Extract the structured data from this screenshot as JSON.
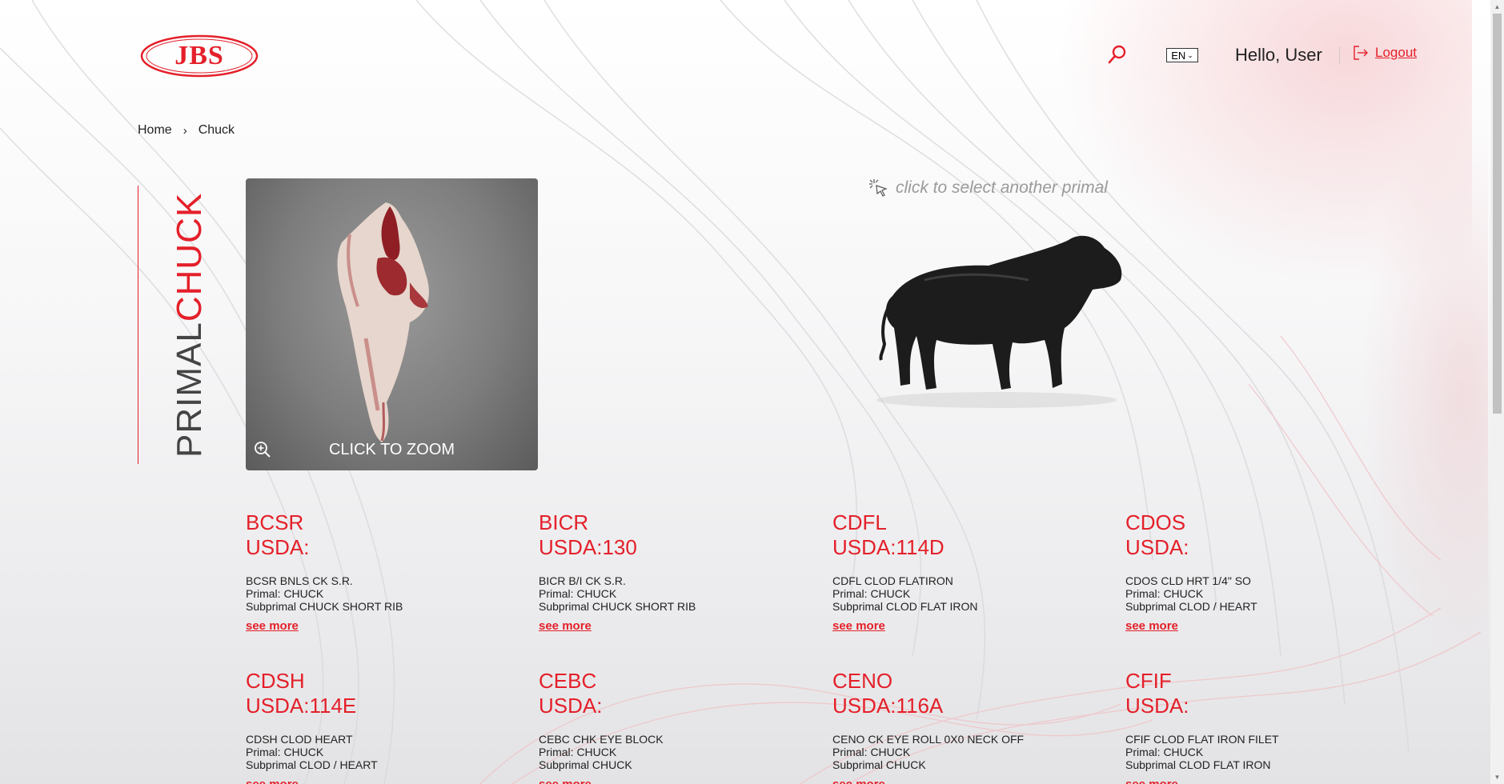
{
  "header": {
    "logo_text": "JBS",
    "language": "EN",
    "greeting": "Hello, User",
    "logout_label": "Logout"
  },
  "breadcrumb": {
    "home": "Home",
    "current": "Chuck"
  },
  "primal": {
    "prefix": "PRIMAL",
    "name": "CHUCK",
    "zoom_label": "CLICK TO ZOOM",
    "select_hint": "click to select another primal"
  },
  "products": [
    {
      "code": "BCSR",
      "usda": "USDA:",
      "name": "BCSR BNLS CK S.R.",
      "primal": "Primal: CHUCK",
      "subprimal": "Subprimal CHUCK SHORT RIB",
      "more": "see more"
    },
    {
      "code": "BICR",
      "usda": "USDA:130",
      "name": "BICR B/I CK S.R.",
      "primal": "Primal: CHUCK",
      "subprimal": "Subprimal CHUCK SHORT RIB",
      "more": "see more"
    },
    {
      "code": "CDFL",
      "usda": "USDA:114D",
      "name": "CDFL CLOD FLATIRON",
      "primal": "Primal: CHUCK",
      "subprimal": "Subprimal CLOD FLAT IRON",
      "more": "see more"
    },
    {
      "code": "CDOS",
      "usda": "USDA:",
      "name": "CDOS CLD HRT 1/4\" SO",
      "primal": "Primal: CHUCK",
      "subprimal": "Subprimal CLOD / HEART",
      "more": "see more"
    },
    {
      "code": "CDSH",
      "usda": "USDA:114E",
      "name": "CDSH CLOD HEART",
      "primal": "Primal: CHUCK",
      "subprimal": "Subprimal CLOD / HEART",
      "more": "see more"
    },
    {
      "code": "CEBC",
      "usda": "USDA:",
      "name": "CEBC CHK EYE BLOCK",
      "primal": "Primal: CHUCK",
      "subprimal": "Subprimal CHUCK",
      "more": "see more"
    },
    {
      "code": "CENO",
      "usda": "USDA:116A",
      "name": "CENO CK EYE ROLL 0X0 NECK OFF",
      "primal": "Primal: CHUCK",
      "subprimal": "Subprimal CHUCK",
      "more": "see more"
    },
    {
      "code": "CFIF",
      "usda": "USDA:",
      "name": "CFIF CLOD FLAT IRON FILET",
      "primal": "Primal: CHUCK",
      "subprimal": "Subprimal CLOD FLAT IRON",
      "more": "see more"
    }
  ],
  "colors": {
    "accent": "#e4202a"
  },
  "icons": {
    "search": "search-icon",
    "logout": "logout-icon",
    "zoom": "zoom-in-icon",
    "cursor": "pointer-click-icon"
  }
}
